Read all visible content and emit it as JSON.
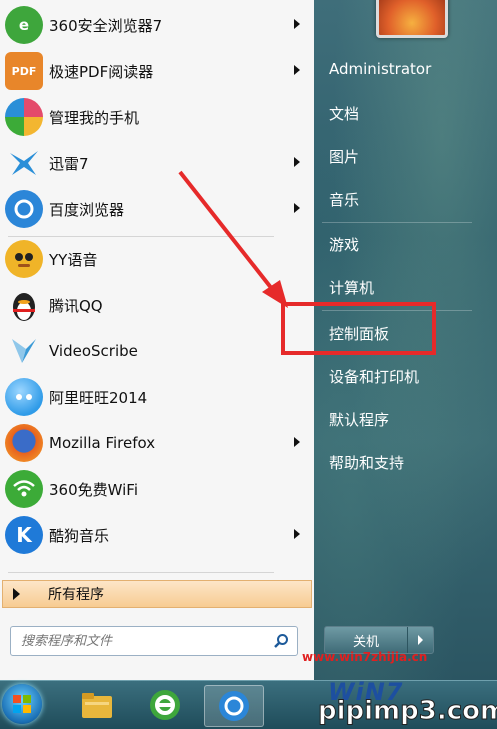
{
  "programs": [
    {
      "label": "360安全浏览器7",
      "icon": "browser-360-icon",
      "color": "#3ea63c",
      "has_submenu": true
    },
    {
      "label": "极速PDF阅读器",
      "icon": "pdf-reader-icon",
      "color": "#e8862a",
      "has_submenu": true
    },
    {
      "label": "管理我的手机",
      "icon": "phone-manager-icon",
      "color": "#e44b6b",
      "has_submenu": false
    },
    {
      "label": "迅雷7",
      "icon": "thunder-icon",
      "color": "#2a8fd8",
      "has_submenu": true
    },
    {
      "label": "百度浏览器",
      "icon": "baidu-browser-icon",
      "color": "#2b86d8",
      "has_submenu": true
    },
    {
      "label": "YY语音",
      "icon": "yy-voice-icon",
      "color": "#f0b428",
      "has_submenu": false
    },
    {
      "label": "腾讯QQ",
      "icon": "qq-penguin-icon",
      "color": "#222222",
      "has_submenu": false
    },
    {
      "label": "VideoScribe",
      "icon": "videoscribe-icon",
      "color": "#3a9ad6",
      "has_submenu": false
    },
    {
      "label": "阿里旺旺2014",
      "icon": "aliwangwang-icon",
      "color": "#2f9be8",
      "has_submenu": false
    },
    {
      "label": "Mozilla Firefox",
      "icon": "firefox-icon",
      "color": "#e8621e",
      "has_submenu": true
    },
    {
      "label": "360免费WiFi",
      "icon": "wifi-icon",
      "color": "#3cab38",
      "has_submenu": false
    },
    {
      "label": "酷狗音乐",
      "icon": "kugou-music-icon",
      "color": "#1f7ad8",
      "has_submenu": true
    }
  ],
  "program_icon_letters": [
    "e",
    "PDF",
    "",
    "",
    "",
    "",
    "",
    "",
    "",
    "",
    "",
    "K"
  ],
  "all_programs": {
    "label": "所有程序"
  },
  "search": {
    "placeholder": "搜索程序和文件"
  },
  "right": {
    "user": "Administrator",
    "items": [
      "文档",
      "图片",
      "音乐",
      "游戏",
      "计算机",
      "控制面板",
      "设备和打印机",
      "默认程序",
      "帮助和支持"
    ]
  },
  "shutdown": {
    "label": "关机"
  },
  "watermark": {
    "url": "www.win7zhijia.cn",
    "logo": "WiN7",
    "site": "pipimp3.com"
  },
  "colors": {
    "highlight": "#e62a2a",
    "all_programs_bg": "#f7cc92"
  }
}
